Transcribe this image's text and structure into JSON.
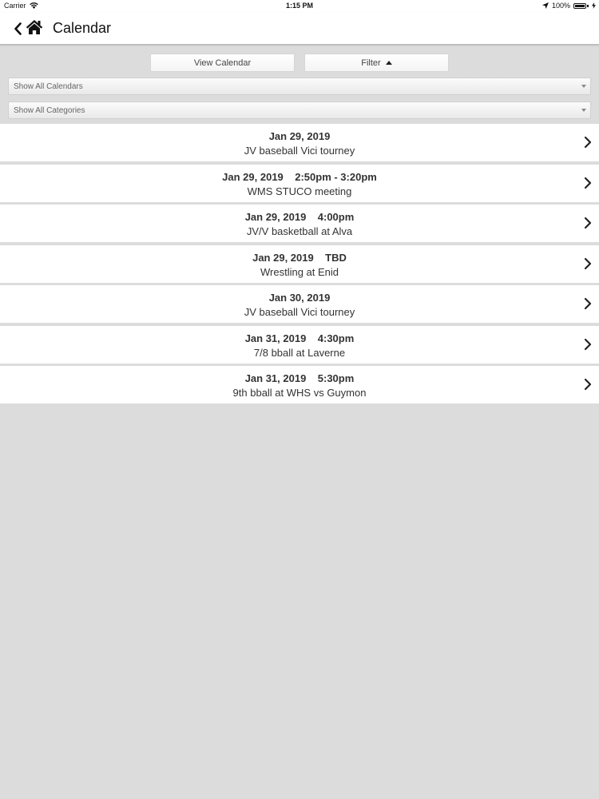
{
  "status_bar": {
    "carrier": "Carrier",
    "time": "1:15 PM",
    "battery": "100%"
  },
  "nav": {
    "title": "Calendar"
  },
  "controls": {
    "view_calendar_label": "View Calendar",
    "filter_label": "Filter",
    "calendar_select": "Show All Calendars",
    "category_select": "Show All Categories"
  },
  "events": [
    {
      "date": "Jan 29, 2019",
      "time": "",
      "title": "JV baseball Vici tourney"
    },
    {
      "date": "Jan 29, 2019",
      "time": "2:50pm - 3:20pm",
      "title": "WMS STUCO meeting"
    },
    {
      "date": "Jan 29, 2019",
      "time": "4:00pm",
      "title": "JV/V basketball at Alva"
    },
    {
      "date": "Jan 29, 2019",
      "time": "TBD",
      "title": "Wrestling at Enid"
    },
    {
      "date": "Jan 30, 2019",
      "time": "",
      "title": "JV baseball Vici tourney"
    },
    {
      "date": "Jan 31, 2019",
      "time": "4:30pm",
      "title": "7/8 bball at Laverne"
    },
    {
      "date": "Jan 31, 2019",
      "time": "5:30pm",
      "title": "9th bball at WHS vs Guymon"
    }
  ],
  "icons": {
    "back": "chevron-left-icon",
    "home": "home-icon",
    "row": "chevron-right-icon"
  },
  "colors": {
    "background": "#dddcdd",
    "row_background": "#ffffff",
    "text": "#333333"
  }
}
